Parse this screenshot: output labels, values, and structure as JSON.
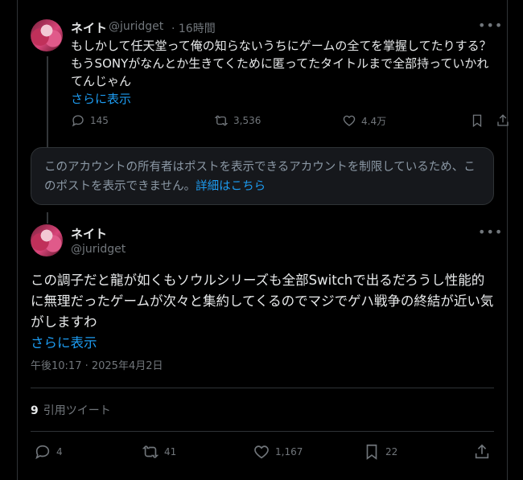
{
  "tweet1": {
    "author_name": "ネイト",
    "author_handle": "@juridget",
    "time_ago": "· 16時間",
    "text": "もしかして任天堂って俺の知らないうちにゲームの全てを掌握してたりする？もうSONYがなんとか生きてくために匿ってたタイトルまで全部持っていかれてんじゃん",
    "show_more": "さらに表示",
    "stats": {
      "replies": "145",
      "retweets": "3,536",
      "likes": "4.4万"
    }
  },
  "notice": {
    "text": "このアカウントの所有者はポストを表示できるアカウントを制限しているため、このポストを表示できません。",
    "link": "詳細はこちら"
  },
  "tweet2": {
    "author_name": "ネイト",
    "author_handle": "@juridget",
    "text": "この調子だと龍が如くもソウルシリーズも全部Switchで出るだろうし性能的に無理だったゲームが次々と集約してくるのでマジでゲハ戦争の終結が近い気がしますわ",
    "show_more": "さらに表示",
    "timestamp": "午後10:17 · 2025年4月2日",
    "quote_count": "9",
    "quote_label": "引用ツイート",
    "stats": {
      "replies": "4",
      "retweets": "41",
      "likes": "1,167",
      "bookmarks": "22"
    }
  },
  "icons": [
    "more-icon",
    "reply-icon",
    "retweet-icon",
    "like-icon",
    "bookmark-icon",
    "share-icon"
  ],
  "colors": {
    "background": "#000000",
    "text": "#e7e9ea",
    "muted": "#71767b",
    "link": "#1d9bf0",
    "border": "#2f3336"
  }
}
